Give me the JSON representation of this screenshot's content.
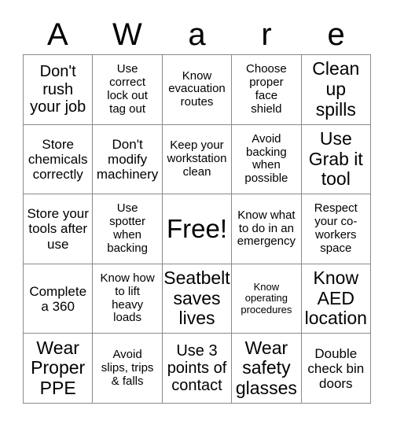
{
  "card": {
    "title_letters": [
      "A",
      "W",
      "a",
      "r",
      "e"
    ],
    "columns": 5,
    "rows": 5,
    "border_color": "#8a8a8a",
    "background_color": "#ffffff",
    "text_color": "#000000",
    "cells": [
      {
        "text": "Don't\nrush\nyour job",
        "size": "l",
        "free": false
      },
      {
        "text": "Use\ncorrect\nlock out\ntag out",
        "size": "s",
        "free": false
      },
      {
        "text": "Know\nevacuation\nroutes",
        "size": "s",
        "free": false
      },
      {
        "text": "Choose\nproper\nface\nshield",
        "size": "s",
        "free": false
      },
      {
        "text": "Clean\nup\nspills",
        "size": "xl",
        "free": false
      },
      {
        "text": "Store\nchemicals\ncorrectly",
        "size": "m",
        "free": false
      },
      {
        "text": "Don't\nmodify\nmachinery",
        "size": "m",
        "free": false
      },
      {
        "text": "Keep your\nworkstation\nclean",
        "size": "s",
        "free": false
      },
      {
        "text": "Avoid\nbacking\nwhen\npossible",
        "size": "s",
        "free": false
      },
      {
        "text": "Use\nGrab it\ntool",
        "size": "xl",
        "free": false
      },
      {
        "text": "Store your\ntools after\nuse",
        "size": "m",
        "free": false
      },
      {
        "text": "Use\nspotter\nwhen\nbacking",
        "size": "s",
        "free": false
      },
      {
        "text": "Free!",
        "size": "free",
        "free": true
      },
      {
        "text": "Know what\nto do in an\nemergency",
        "size": "s",
        "free": false
      },
      {
        "text": "Respect\nyour co-\nworkers\nspace",
        "size": "s",
        "free": false
      },
      {
        "text": "Complete\na 360",
        "size": "m",
        "free": false
      },
      {
        "text": "Know how\nto lift\nheavy\nloads",
        "size": "s",
        "free": false
      },
      {
        "text": "Seatbelt\nsaves\nlives",
        "size": "xl",
        "free": false
      },
      {
        "text": "Know\noperating\nprocedures",
        "size": "xs",
        "free": false
      },
      {
        "text": "Know\nAED\nlocation",
        "size": "xl",
        "free": false
      },
      {
        "text": "Wear\nProper\nPPE",
        "size": "xl",
        "free": false
      },
      {
        "text": "Avoid\nslips, trips\n& falls",
        "size": "s",
        "free": false
      },
      {
        "text": "Use 3\npoints of\ncontact",
        "size": "l",
        "free": false
      },
      {
        "text": "Wear\nsafety\nglasses",
        "size": "xl",
        "free": false
      },
      {
        "text": "Double\ncheck bin\ndoors",
        "size": "m",
        "free": false
      }
    ]
  }
}
